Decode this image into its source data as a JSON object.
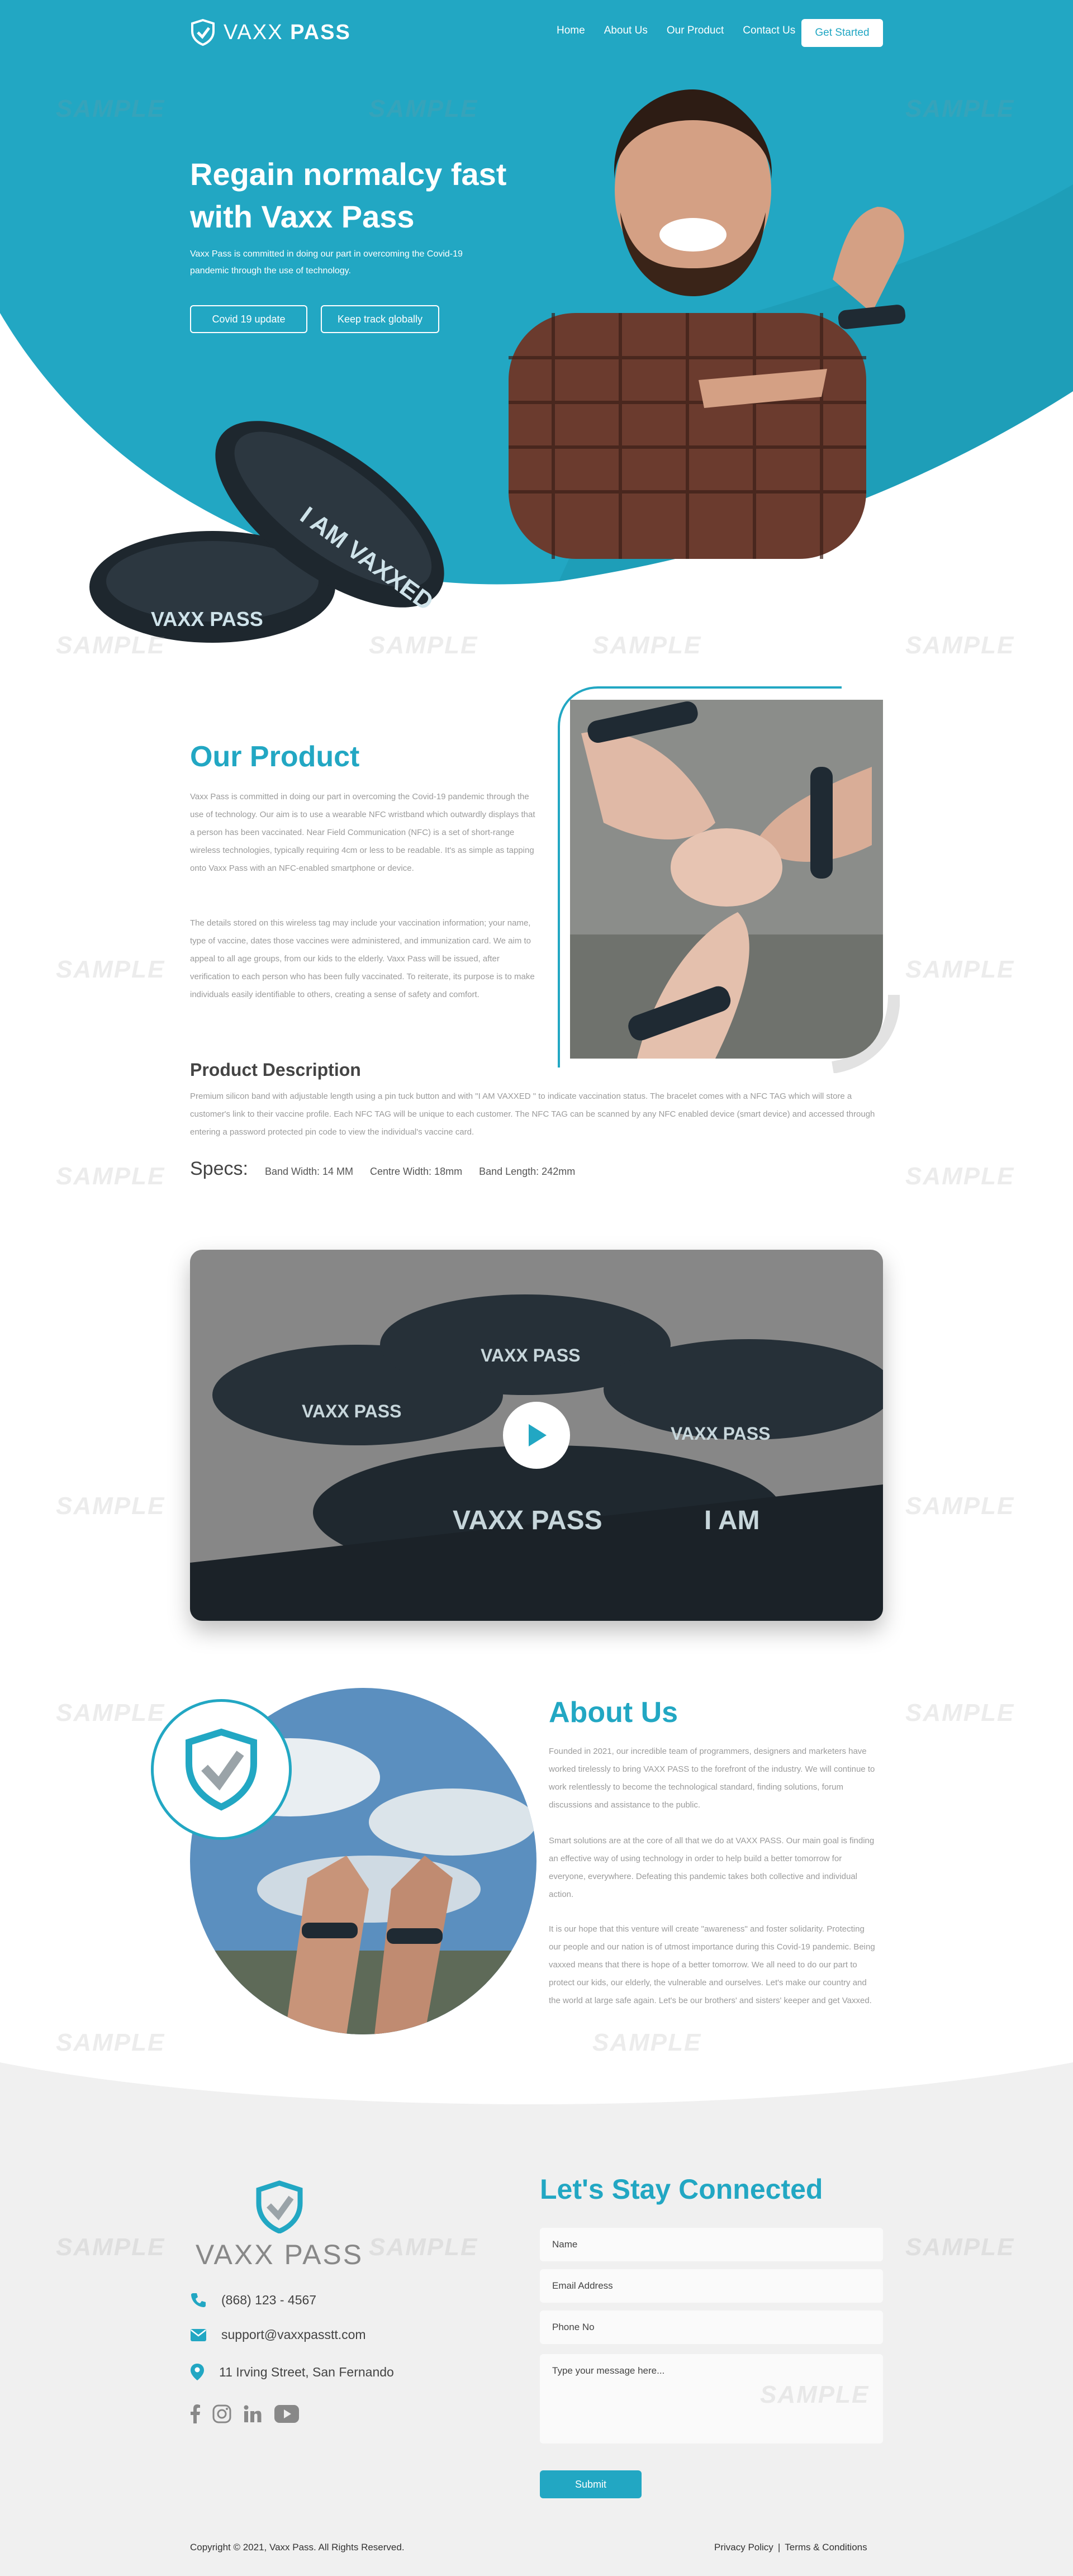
{
  "brand": {
    "name_light": "VAXX",
    "name_bold": "PASS",
    "accent": "#22a7c3"
  },
  "nav": {
    "items": [
      "Home",
      "About Us",
      "Our Product",
      "Contact Us"
    ],
    "cta": "Get Started"
  },
  "hero": {
    "title": "Regain normalcy fast with Vaxx Pass",
    "subtitle": "Vaxx Pass is committed in doing our part in overcoming the Covid-19 pandemic through the use of technology.",
    "buttons": [
      "Covid 19 update",
      "Keep track globally"
    ],
    "band_text_1": "I AM VAXXED",
    "band_text_2": "VAXX PASS"
  },
  "product": {
    "title": "Our Product",
    "p1": "Vaxx Pass is committed in doing our part in overcoming the Covid-19 pandemic through the use of technology. Our aim is to use a wearable NFC wristband which outwardly displays that a person has been vaccinated. Near Field Communication (NFC) is a set of short-range wireless technologies, typically requiring 4cm or less to be readable. It's as simple as tapping onto Vaxx Pass with an NFC-enabled smartphone or device.",
    "p2": "The details stored on this wireless tag may include your vaccination information; your name, type of vaccine, dates those vaccines were administered, and immunization card. We aim to appeal to all age groups, from our kids to the elderly. Vaxx Pass will be issued, after verification to each person who has been fully vaccinated. To reiterate, its purpose is to make individuals easily identifiable to others, creating a sense of safety and comfort.",
    "desc_title": "Product Description",
    "desc": "Premium silicon band with adjustable length using a pin tuck button and with \"I AM VAXXED \" to indicate vaccination status.  The bracelet comes with a NFC TAG which will store a customer's link to their vaccine profile.  Each NFC TAG will be unique to each customer.  The NFC TAG can be scanned by any NFC enabled device (smart device) and accessed through entering a password protected pin code to view the individual's vaccine card.",
    "specs_label": "Specs:",
    "specs": [
      "Band Width: 14 MM",
      "Centre Width: 18mm",
      "Band Length: 242mm"
    ]
  },
  "video": {
    "band_text": "VAXX PASS",
    "band_text_2": "I AM"
  },
  "about": {
    "title": "About Us",
    "p1": "Founded in 2021, our incredible team of programmers, designers and marketers have worked tirelessly to bring VAXX PASS to the forefront of the industry. We will continue to work relentlessly to become the technological standard, finding solutions, forum discussions and assistance to the public.",
    "p2": "Smart solutions are at the core of all that we do at VAXX PASS. Our main goal is finding an effective way of using technology in order to help build a better tomorrow for everyone, everywhere. Defeating this pandemic takes both collective and individual action.",
    "p3": "It is our hope that this venture will create \"awareness\" and foster solidarity. Protecting our people and our nation is of utmost importance during this Covid-19 pandemic. Being vaxxed means that there is hope of a better tomorrow. We all need to do our part to protect our kids, our elderly, the vulnerable and ourselves. Let's make our country and the world at large safe again. Let's be our brothers' and sisters' keeper and get Vaxxed."
  },
  "footer": {
    "logo_text": "VAXX PASS",
    "phone": "(868) 123 - 4567",
    "email": "support@vaxxpasstt.com",
    "address": "11 Irving Street, San Fernando",
    "social_icons": [
      "facebook-icon",
      "instagram-icon",
      "linkedin-icon",
      "youtube-icon"
    ],
    "form_title": "Let's Stay Connected",
    "fields": {
      "name": "Name",
      "email": "Email Address",
      "phone": "Phone No",
      "message": "Type your message here..."
    },
    "submit": "Submit",
    "copyright": "Copyright © 2021, Vaxx Pass.  All Rights Reserved.",
    "privacy": "Privacy Policy",
    "separator": "|",
    "terms": "Terms & Conditions"
  },
  "watermark": "SAMPLE"
}
